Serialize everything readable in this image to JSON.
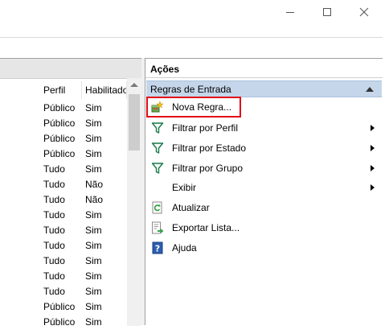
{
  "window": {
    "controls": [
      {
        "name": "minimize-icon"
      },
      {
        "name": "maximize-icon"
      },
      {
        "name": "close-icon"
      }
    ]
  },
  "list": {
    "columns": {
      "perfil": "Perfil",
      "habilitado": "Habilitado"
    },
    "rows": [
      {
        "perfil": "Público",
        "habilitado": "Sim"
      },
      {
        "perfil": "Público",
        "habilitado": "Sim"
      },
      {
        "perfil": "Público",
        "habilitado": "Sim"
      },
      {
        "perfil": "Público",
        "habilitado": "Sim"
      },
      {
        "perfil": "Tudo",
        "habilitado": "Sim"
      },
      {
        "perfil": "Tudo",
        "habilitado": "Não"
      },
      {
        "perfil": "Tudo",
        "habilitado": "Não"
      },
      {
        "perfil": "Tudo",
        "habilitado": "Sim"
      },
      {
        "perfil": "Tudo",
        "habilitado": "Sim"
      },
      {
        "perfil": "Tudo",
        "habilitado": "Sim"
      },
      {
        "perfil": "Tudo",
        "habilitado": "Sim"
      },
      {
        "perfil": "Tudo",
        "habilitado": "Sim"
      },
      {
        "perfil": "Tudo",
        "habilitado": "Sim"
      },
      {
        "perfil": "Público",
        "habilitado": "Sim"
      },
      {
        "perfil": "Público",
        "habilitado": "Sim"
      }
    ]
  },
  "actions": {
    "title": "Ações",
    "section": "Regras de Entrada",
    "items": [
      {
        "label": "Nova Regra...",
        "icon": "new-rule-icon",
        "submenu": false
      },
      {
        "label": "Filtrar por Perfil",
        "icon": "filter-icon",
        "submenu": true
      },
      {
        "label": "Filtrar por Estado",
        "icon": "filter-icon",
        "submenu": true
      },
      {
        "label": "Filtrar por Grupo",
        "icon": "filter-icon",
        "submenu": true
      },
      {
        "label": "Exibir",
        "icon": "",
        "submenu": true
      },
      {
        "label": "Atualizar",
        "icon": "refresh-icon",
        "submenu": false
      },
      {
        "label": "Exportar Lista...",
        "icon": "export-list-icon",
        "submenu": false
      },
      {
        "label": "Ajuda",
        "icon": "help-icon",
        "submenu": false
      }
    ],
    "highlight_color": "#e20b17",
    "section_color": "#c5d6ea"
  }
}
